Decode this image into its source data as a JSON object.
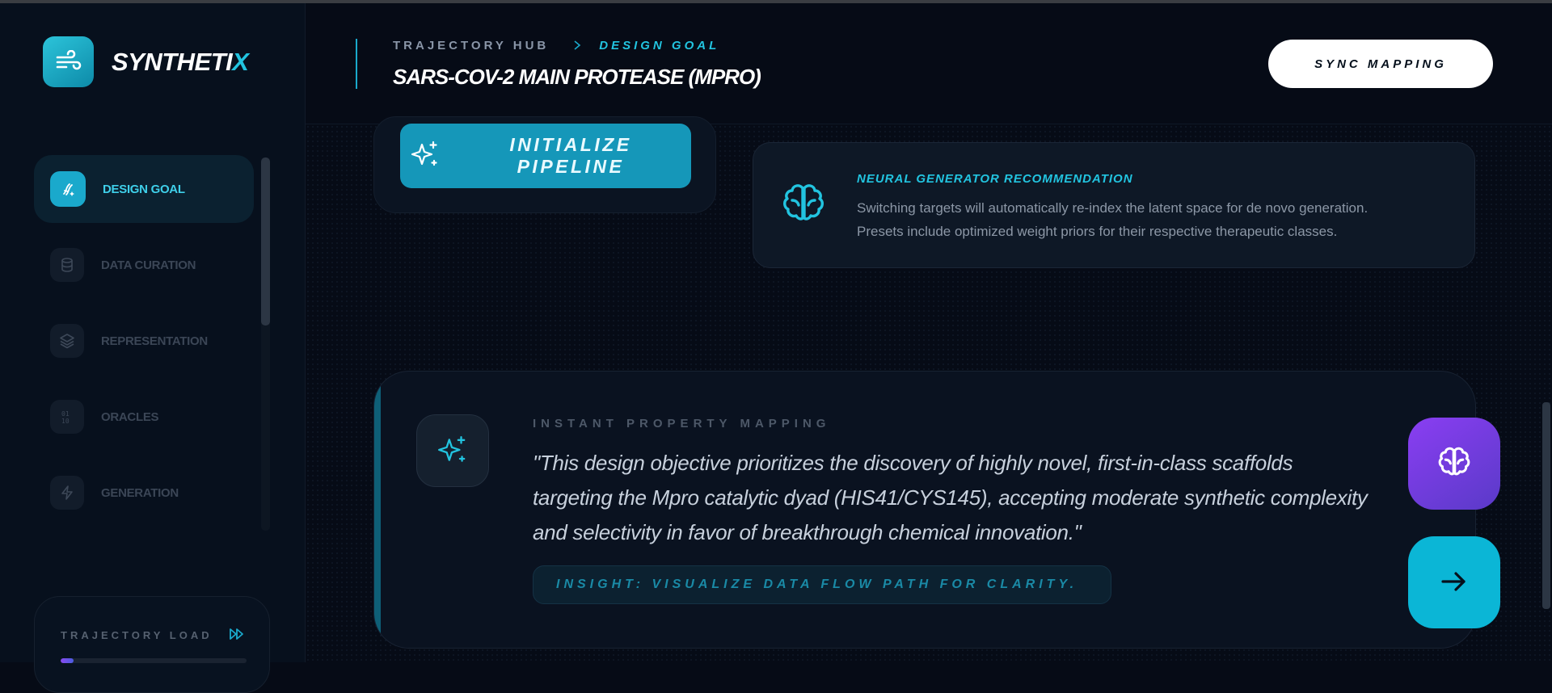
{
  "brand": {
    "name_main": "SYNTHETI",
    "name_accent": "X"
  },
  "sidebar": {
    "items": [
      {
        "label": "DESIGN GOAL",
        "icon": "dna-sparkle-icon",
        "active": true
      },
      {
        "label": "DATA CURATION",
        "icon": "database-icon",
        "active": false
      },
      {
        "label": "REPRESENTATION",
        "icon": "layers-icon",
        "active": false
      },
      {
        "label": "ORACLES",
        "icon": "binary-icon",
        "active": false
      },
      {
        "label": "GENERATION",
        "icon": "bolt-icon",
        "active": false
      }
    ],
    "load": {
      "label": "TRAJECTORY LOAD",
      "progress": 0.07
    }
  },
  "header": {
    "breadcrumb_hub": "TRAJECTORY HUB",
    "breadcrumb_current": "DESIGN GOAL",
    "title": "SARS-COV-2 MAIN PROTEASE (MPRO)",
    "sync_label": "SYNC MAPPING"
  },
  "pipeline": {
    "button_label": "INITIALIZE PIPELINE"
  },
  "recommendation": {
    "title": "NEURAL GENERATOR RECOMMENDATION",
    "line1": "Switching targets will automatically re-index the latent space for de novo generation.",
    "line2": "Presets include optimized weight priors for their respective therapeutic classes."
  },
  "mapping": {
    "label": "INSTANT PROPERTY MAPPING",
    "quote_line1": "\"This design objective prioritizes the discovery of highly novel, first-in-class scaffolds",
    "quote_line2": "targeting the Mpro catalytic dyad (HIS41/CYS145), accepting moderate synthetic complexity",
    "quote_line3": "and selectivity in favor of breakthrough chemical innovation.\"",
    "insight": "INSIGHT: VISUALIZE DATA FLOW PATH FOR CLARITY."
  },
  "colors": {
    "accent": "#22c4e0",
    "brand_button": "#1597b9",
    "purple": "#8a3ef2"
  }
}
